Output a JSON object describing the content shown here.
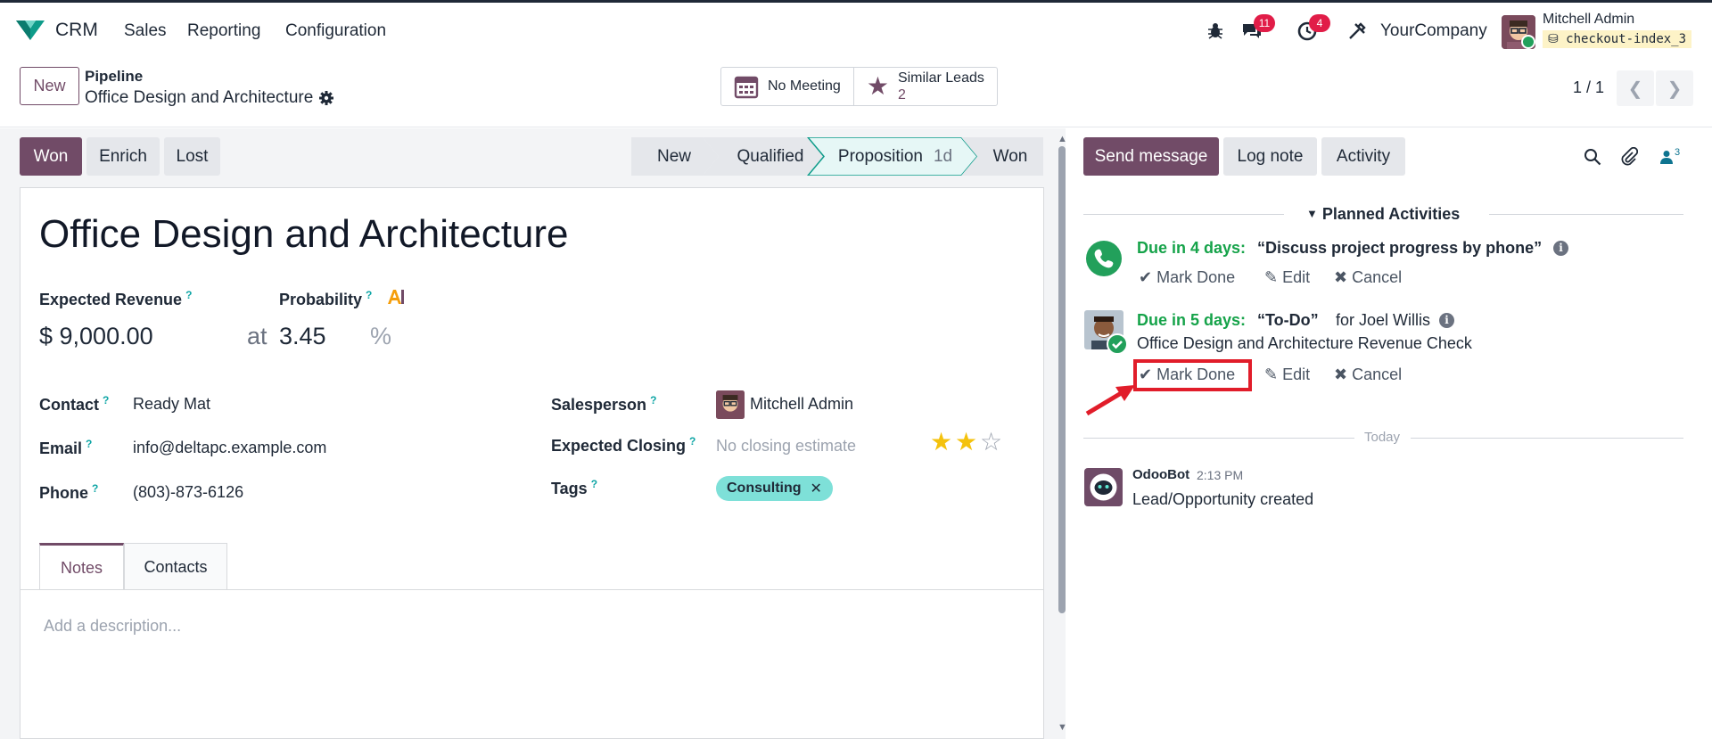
{
  "navbar": {
    "app_name": "CRM",
    "menus": [
      "Sales",
      "Reporting",
      "Configuration"
    ],
    "messages_count": "11",
    "activities_count": "4",
    "company": "YourCompany",
    "user_name": "Mitchell Admin",
    "database": "checkout-index_3"
  },
  "control": {
    "new_label": "New",
    "breadcrumb_parent": "Pipeline",
    "breadcrumb_current": "Office Design and Architecture",
    "smart_meeting": "No Meeting",
    "smart_similar_label": "Similar Leads",
    "smart_similar_count": "2",
    "pager": "1 / 1"
  },
  "statusbar": {
    "won": "Won",
    "enrich": "Enrich",
    "lost": "Lost",
    "stages": [
      {
        "label": "New",
        "active": false
      },
      {
        "label": "Qualified",
        "active": false
      },
      {
        "label": "Proposition",
        "duration": "1d",
        "active": true
      },
      {
        "label": "Won",
        "active": false
      }
    ]
  },
  "lead": {
    "name": "Office Design and Architecture",
    "expected_revenue_label": "Expected Revenue",
    "expected_revenue": "$ 9,000.00",
    "at": "at",
    "probability_label": "Probability",
    "probability": "3.45",
    "percent": "%",
    "contact_label": "Contact",
    "contact": "Ready Mat",
    "email_label": "Email",
    "email": "info@deltapc.example.com",
    "phone_label": "Phone",
    "phone": "(803)-873-6126",
    "salesperson_label": "Salesperson",
    "salesperson": "Mitchell Admin",
    "closing_label": "Expected Closing",
    "closing_placeholder": "No closing estimate",
    "priority_stars": 2,
    "priority_max": 3,
    "tags_label": "Tags",
    "tag": "Consulting",
    "tabs": [
      "Notes",
      "Contacts"
    ],
    "description_placeholder": "Add a description..."
  },
  "chatter": {
    "send_message": "Send message",
    "log_note": "Log note",
    "activity": "Activity",
    "followers_count": "3",
    "planned_title": "Planned Activities",
    "activities": [
      {
        "due": "Due in 4 days:",
        "summary": "“Discuss project progress by phone”",
        "mark_done": "Mark Done",
        "edit": "Edit",
        "cancel": "Cancel"
      },
      {
        "due": "Due in 5 days:",
        "summary": "“To-Do”",
        "assignee": "for Joel Willis",
        "note": "Office Design and Architecture Revenue Check",
        "mark_done": "Mark Done",
        "edit": "Edit",
        "cancel": "Cancel"
      }
    ],
    "today": "Today",
    "message": {
      "author": "OdooBot",
      "time": "2:13 PM",
      "body": "Lead/Opportunity created"
    }
  },
  "colors": {
    "brand": "#714b67",
    "success": "#16a34a",
    "highlight": "#e11d2a",
    "tag": "#7ee0d8",
    "star": "#f4c20d"
  }
}
